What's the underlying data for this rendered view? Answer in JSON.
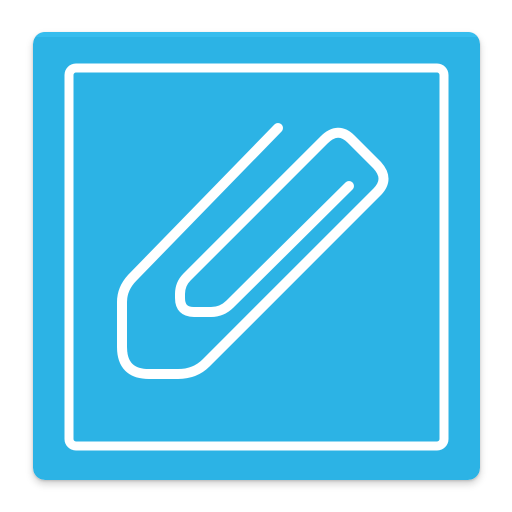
{
  "icon": {
    "name": "paperclip-attachment-icon",
    "background_color": "#2cb3e5",
    "highlight_color": "#36bdee",
    "foreground_color": "#ffffff"
  }
}
